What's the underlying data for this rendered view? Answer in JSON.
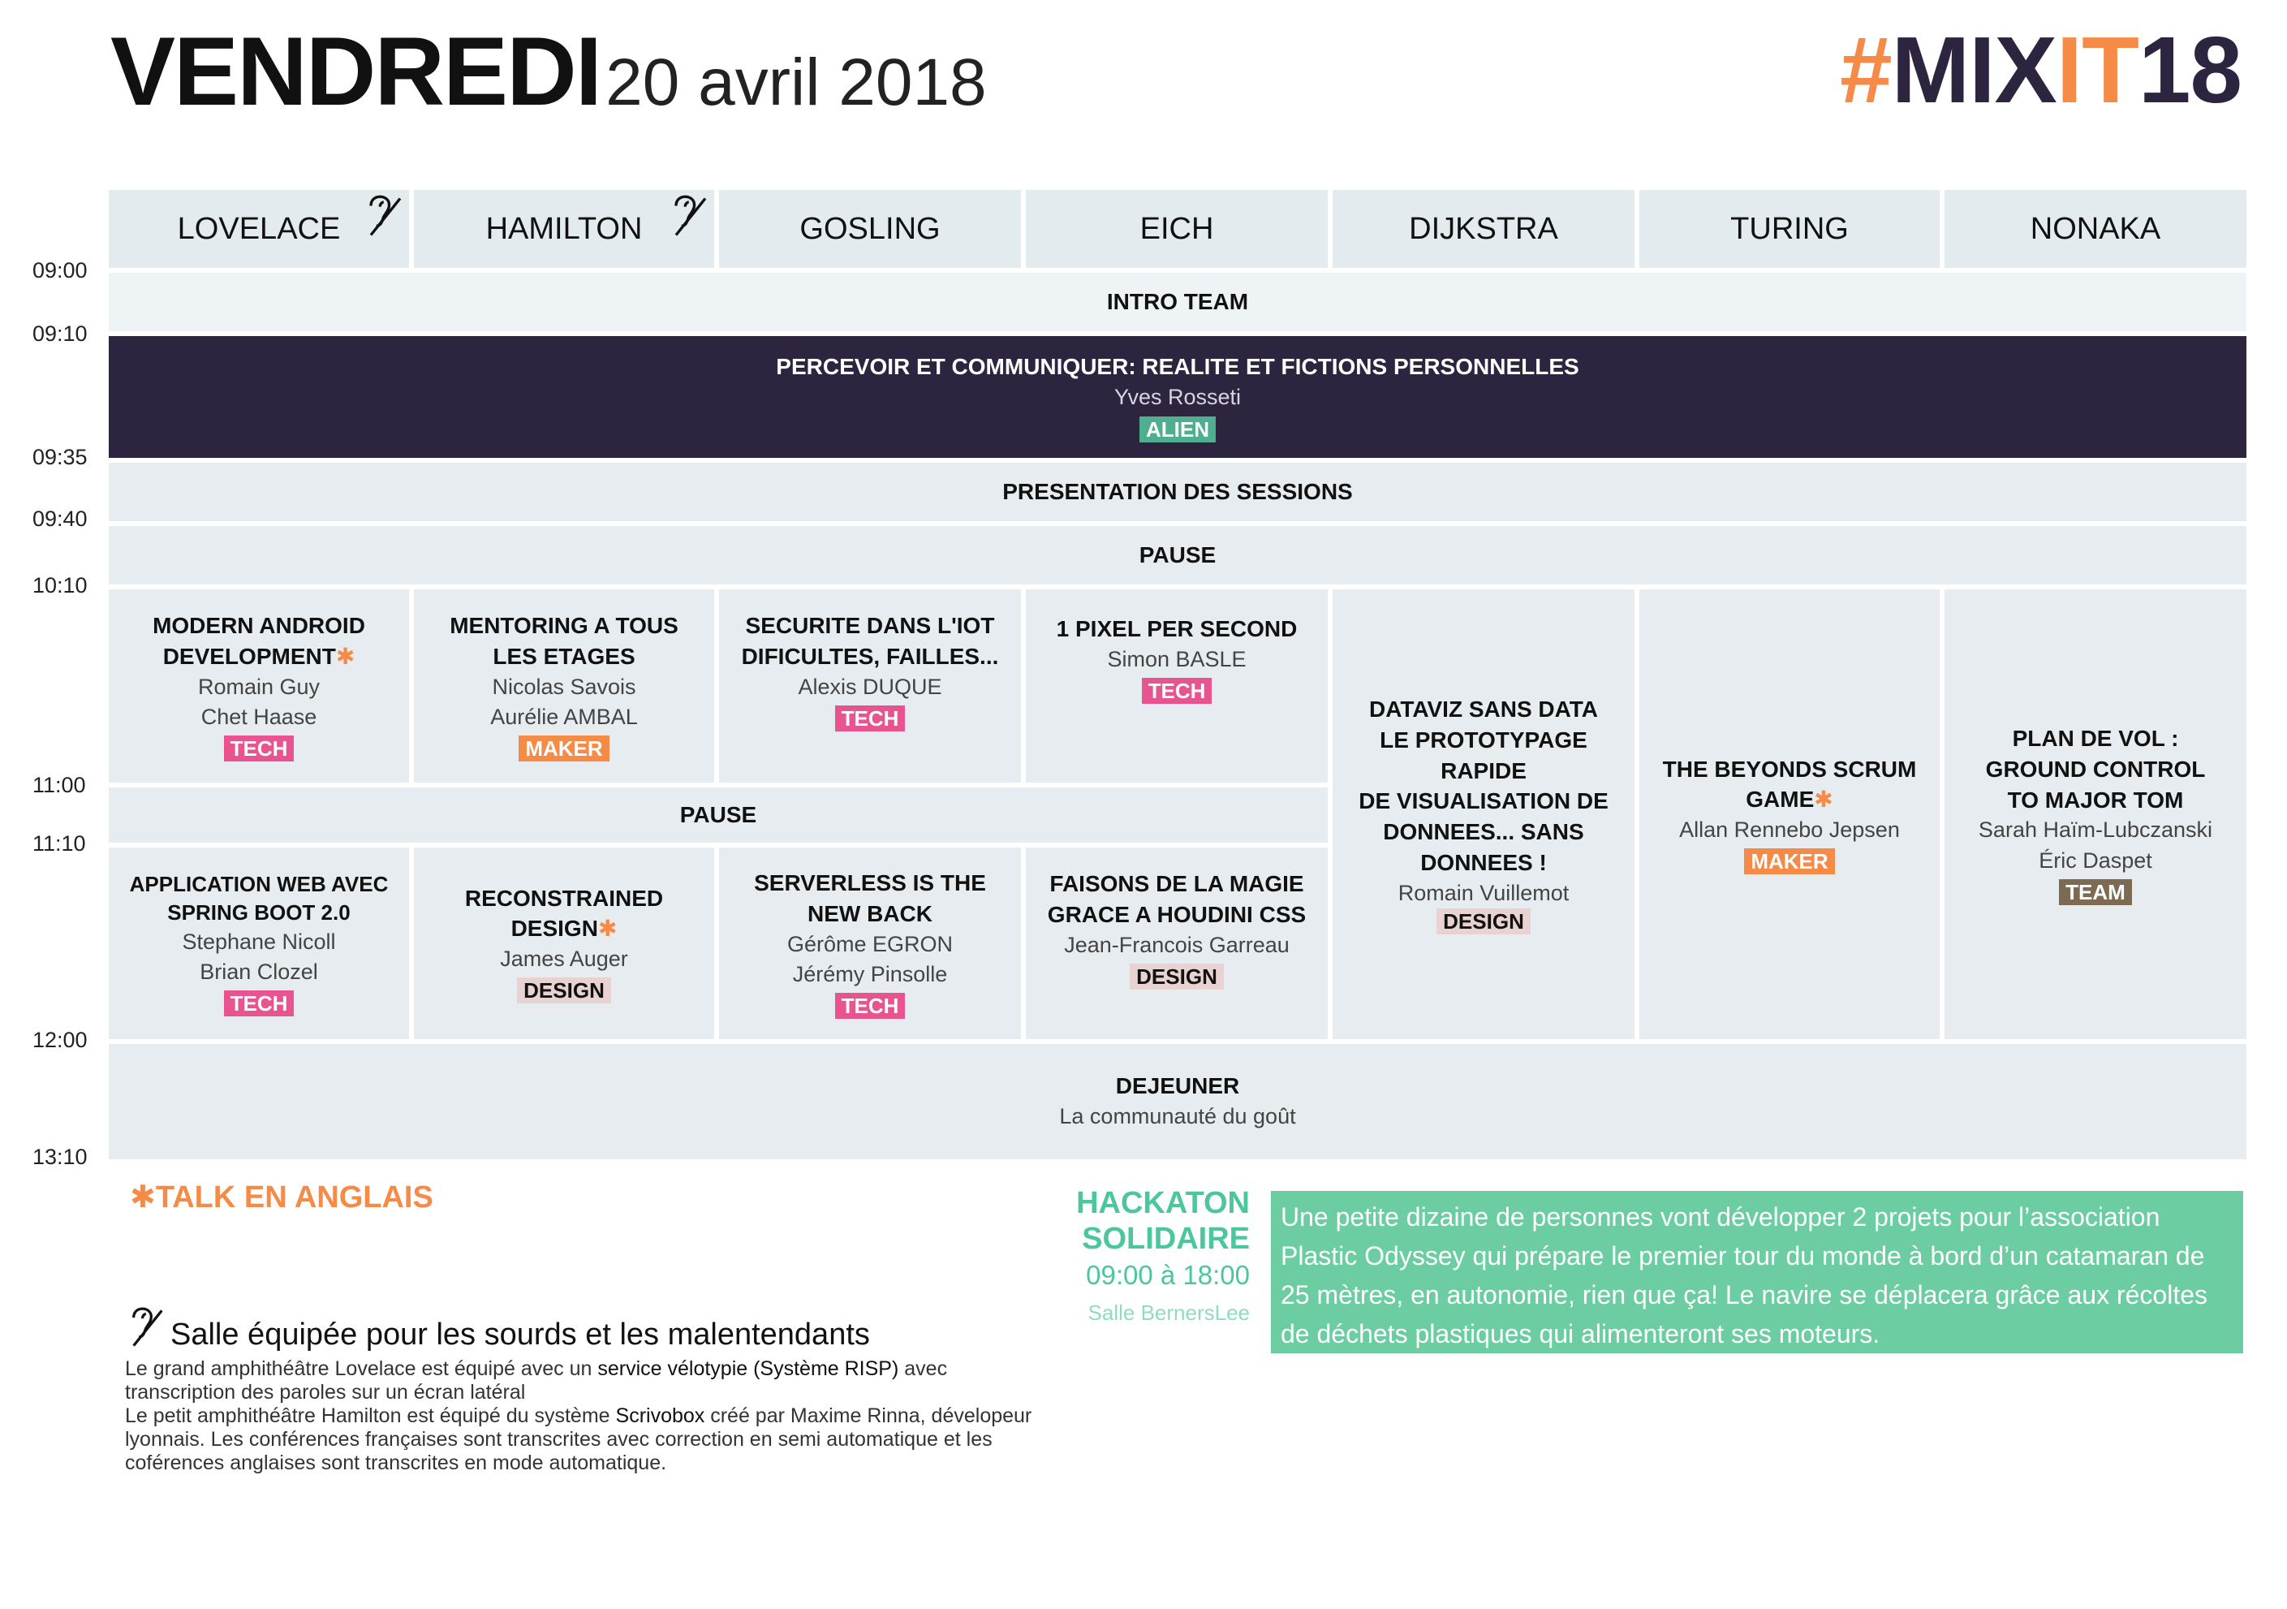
{
  "header": {
    "day": "VENDREDI",
    "date": "20 avril 2018",
    "logo_hash": "#",
    "logo_mix": "MIX",
    "logo_it": "IT",
    "logo_year": "18"
  },
  "rooms": [
    "LOVELACE",
    "HAMILTON",
    "GOSLING",
    "EICH",
    "DIJKSTRA",
    "TURING",
    "NONAKA"
  ],
  "times": [
    "09:00",
    "09:10",
    "09:35",
    "09:40",
    "10:10",
    "11:00",
    "11:10",
    "12:00",
    "13:10"
  ],
  "plenary": {
    "intro": "INTRO TEAM",
    "keynote_title": "PERCEVOIR ET COMMUNIQUER: REALITE ET FICTIONS PERSONNELLES",
    "keynote_speaker": "Yves Rosseti",
    "keynote_tag": "ALIEN",
    "presentation": "PRESENTATION DES SESSIONS",
    "pause1": "PAUSE",
    "pause2": "PAUSE",
    "lunch_title": "DEJEUNER",
    "lunch_sub": "La communauté du goût"
  },
  "sessions": {
    "lovelace1": {
      "title1": "MODERN ANDROID",
      "title2": "DEVELOPMENT",
      "sp1": "Romain Guy",
      "sp2": "Chet Haase",
      "tag": "TECH"
    },
    "hamilton1": {
      "title1": "MENTORING A TOUS",
      "title2": "LES ETAGES",
      "sp1": "Nicolas Savois",
      "sp2": "Aurélie AMBAL",
      "tag": "MAKER"
    },
    "gosling1": {
      "title1": "SECURITE DANS L'IOT",
      "title2": "DIFICULTES, FAILLES...",
      "sp1": "Alexis DUQUE",
      "tag": "TECH"
    },
    "eich1": {
      "title1": "1 PIXEL PER SECOND",
      "sp1": "Simon BASLE",
      "tag": "TECH"
    },
    "dijkstra": {
      "title1": "DATAVIZ SANS DATA",
      "title2": "LE PROTOTYPAGE RAPIDE",
      "title3": "DE VISUALISATION DE",
      "title4": "DONNEES... SANS",
      "title5": "DONNEES !",
      "sp1": "Romain Vuillemot",
      "tag": "DESIGN"
    },
    "turing": {
      "title1": "THE BEYONDS SCRUM",
      "title2": "GAME",
      "sp1": "Allan Rennebo Jepsen",
      "tag": "MAKER"
    },
    "nonaka": {
      "title1": "PLAN DE VOL :",
      "title2": "GROUND CONTROL",
      "title3": "TO MAJOR TOM",
      "sp1": "Sarah Haïm-Lubczanski",
      "sp2": "Éric Daspet",
      "tag": "TEAM"
    },
    "lovelace2": {
      "title1": "APPLICATION WEB AVEC",
      "title2": "SPRING BOOT 2.0",
      "sp1": "Stephane Nicoll",
      "sp2": "Brian Clozel",
      "tag": "TECH"
    },
    "hamilton2": {
      "title1": "RECONSTRAINED",
      "title2": "DESIGN",
      "sp1": "James Auger",
      "tag": "DESIGN"
    },
    "gosling2": {
      "title1": "SERVERLESS IS THE",
      "title2": "NEW BACK",
      "sp1": "Gérôme EGRON",
      "sp2": "Jérémy Pinsolle",
      "tag": "TECH"
    },
    "eich2": {
      "title1": "FAISONS DE LA MAGIE",
      "title2": "GRACE A HOUDINI CSS",
      "sp1": "Jean-Francois Garreau",
      "tag": "DESIGN"
    }
  },
  "legend": {
    "asterisk": "✱",
    "english": "TALK EN ANGLAIS",
    "deaf_title": "Salle équipée pour les sourds et les malentendants",
    "l1a": "Le grand amphithéâtre Lovelace est équipé avec un ",
    "l1b": "service vélotypie (Système RISP)",
    "l1c": " avec transcription des paroles sur un écran latéral",
    "l2a": "Le petit amphithéâtre Hamilton est équipé du système ",
    "l2b": "Scrivobox",
    "l2c": " créé par Maxime Rinna, dévelopeur lyonnais. Les conférences françaises sont transcrites avec correction en semi automatique et les coférences anglaises sont transcrites en mode automatique."
  },
  "hackathon": {
    "title1": "HACKATON",
    "title2": "SOLIDAIRE",
    "hours": "09:00 à 18:00",
    "room": "Salle BernersLee",
    "description": "Une petite dizaine de personnes vont développer 2 projets pour l’association Plastic Odyssey qui prépare le premier tour du monde à bord d’un catamaran de 25 mètres, en autonomie, rien que ça! Le navire se déplacera grâce aux récoltes de déchets plastiques qui alimenteront ses moteurs."
  },
  "colors": {
    "accent": "#f68b48",
    "dark": "#2d2540",
    "tech": "#e7548f",
    "maker": "#f68b48",
    "design": "#e9d2d2",
    "team": "#7c6a52",
    "alien": "#4fae8e",
    "hackathon": "#6dcda2"
  }
}
